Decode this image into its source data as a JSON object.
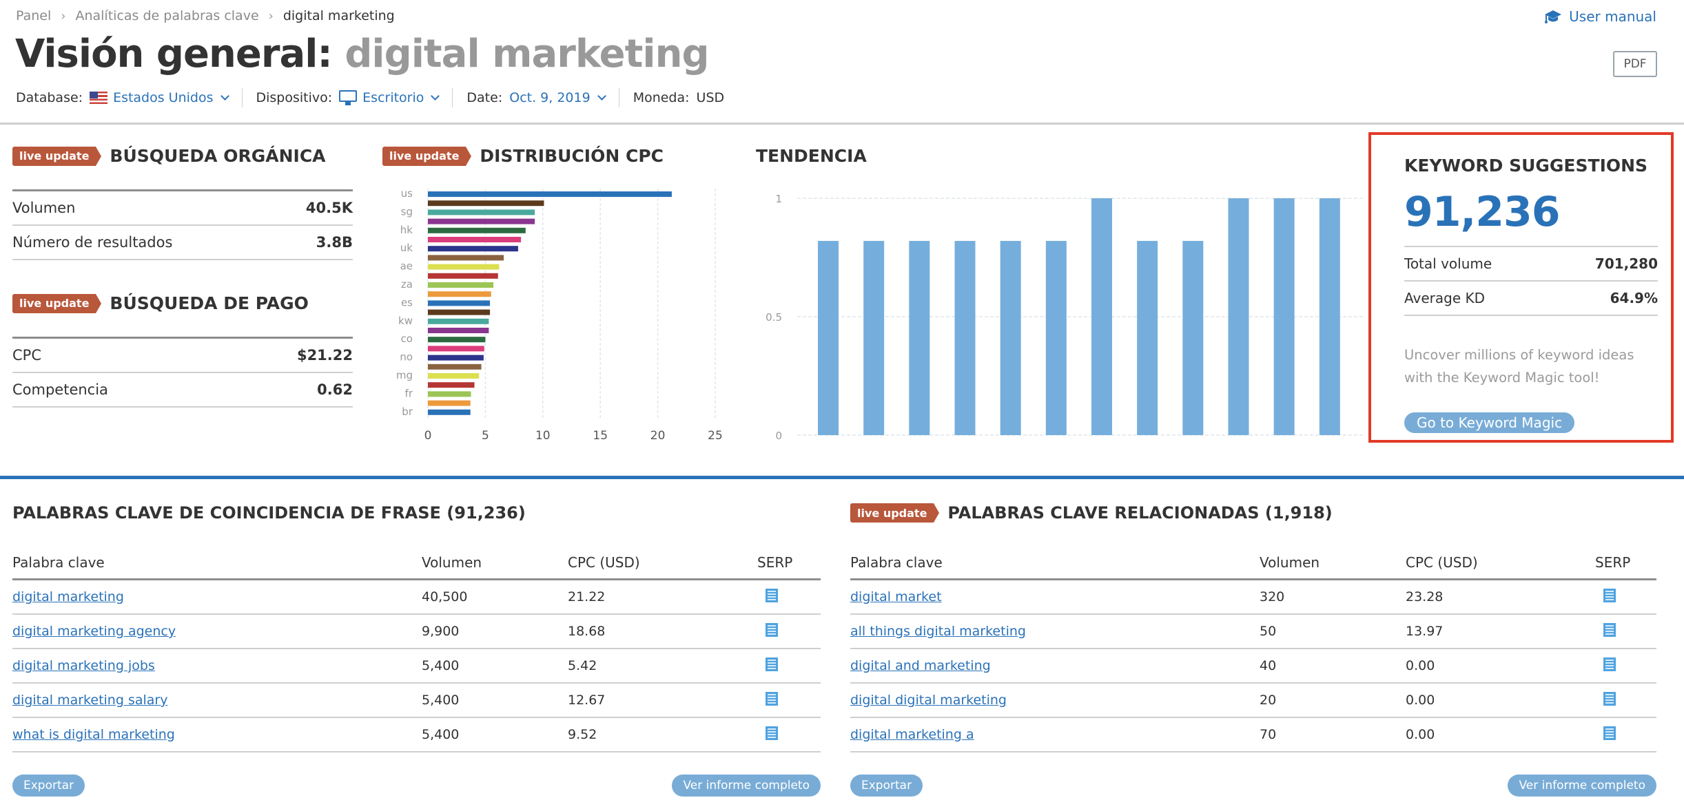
{
  "breadcrumb": [
    "Panel",
    "Analíticas de palabras clave",
    "digital marketing"
  ],
  "header": {
    "user_manual": "User manual",
    "title_prefix": "Visión general:",
    "title_keyword": "digital marketing",
    "pdf_label": "PDF"
  },
  "filters": {
    "database_label": "Database:",
    "database_value": "Estados Unidos",
    "device_label": "Dispositivo:",
    "device_value": "Escritorio",
    "date_label": "Date:",
    "date_value": "Oct. 9, 2019",
    "currency_label": "Moneda:",
    "currency_value": "USD"
  },
  "badge": "live update",
  "organic": {
    "title": "BÚSQUEDA ORGÁNICA",
    "rows": [
      {
        "label": "Volumen",
        "value": "40.5K"
      },
      {
        "label": "Número de resultados",
        "value": "3.8B"
      }
    ]
  },
  "paid": {
    "title": "BÚSQUEDA DE PAGO",
    "rows": [
      {
        "label": "CPC",
        "value": "$21.22"
      },
      {
        "label": "Competencia",
        "value": "0.62"
      }
    ]
  },
  "cpc_panel": {
    "title": "DISTRIBUCIÓN CPC"
  },
  "trend_panel": {
    "title": "TENDENCIA"
  },
  "chart_data": [
    {
      "type": "bar",
      "orientation": "horizontal",
      "title": "DISTRIBUCIÓN CPC",
      "categories": [
        "us",
        "",
        "sg",
        "",
        "hk",
        "",
        "uk",
        "",
        "ae",
        "",
        "za",
        "",
        "es",
        "",
        "kw",
        "",
        "co",
        "",
        "no",
        "",
        "mg",
        "",
        "fr",
        "",
        "br"
      ],
      "values": [
        21.22,
        10.1,
        9.3,
        9.3,
        8.5,
        8.1,
        7.85,
        6.6,
        6.2,
        6.1,
        5.7,
        5.5,
        5.4,
        5.4,
        5.3,
        5.3,
        5.0,
        4.9,
        4.85,
        4.65,
        4.45,
        4.05,
        3.75,
        3.7,
        3.7
      ],
      "colors": [
        "#2a72b8",
        "#5c3a1e",
        "#4aa99d",
        "#8a3590",
        "#2c6b3f",
        "#db3d7c",
        "#2c358c",
        "#8a6240",
        "#dcdf50",
        "#b53634",
        "#9bc554",
        "#ed9a3d",
        "#2a72b8",
        "#5c3a1e",
        "#4aa99d",
        "#8a3590",
        "#2c6b3f",
        "#db3d7c",
        "#2c358c",
        "#8a6240",
        "#dcdf50",
        "#b53634",
        "#9bc554",
        "#ed9a3d",
        "#2a72b8"
      ],
      "xlim": [
        0,
        25
      ],
      "xticks": [
        0,
        5,
        10,
        15,
        20,
        25
      ],
      "grid": true,
      "xlabel": "",
      "ylabel": ""
    },
    {
      "type": "bar",
      "title": "TENDENCIA",
      "values": [
        0.82,
        0.82,
        0.82,
        0.82,
        0.82,
        0.82,
        1,
        0.82,
        0.82,
        1,
        1,
        1
      ],
      "ylim": [
        0,
        1
      ],
      "yticks": [
        "0",
        "0.5",
        "1"
      ],
      "color": "#75aedc",
      "grid": true
    }
  ],
  "keyword_suggestions": {
    "title": "KEYWORD SUGGESTIONS",
    "count": "91,236",
    "rows": [
      {
        "label": "Total volume",
        "value": "701,280"
      },
      {
        "label": "Average KD",
        "value": "64.9%"
      }
    ],
    "note": "Uncover millions of keyword ideas with the Keyword Magic tool!",
    "button": "Go to Keyword Magic"
  },
  "phrase_match": {
    "title": "PALABRAS CLAVE DE COINCIDENCIA DE FRASE (91,236)",
    "columns": [
      "Palabra clave",
      "Volumen",
      "CPC (USD)",
      "SERP"
    ],
    "rows": [
      {
        "keyword": "digital marketing",
        "volume": "40,500",
        "cpc": "21.22"
      },
      {
        "keyword": "digital marketing agency",
        "volume": "9,900",
        "cpc": "18.68"
      },
      {
        "keyword": "digital marketing jobs",
        "volume": "5,400",
        "cpc": "5.42"
      },
      {
        "keyword": "digital marketing salary",
        "volume": "5,400",
        "cpc": "12.67"
      },
      {
        "keyword": "what is digital marketing",
        "volume": "5,400",
        "cpc": "9.52"
      }
    ],
    "export": "Exportar",
    "full_report": "Ver informe completo"
  },
  "related": {
    "title": "PALABRAS CLAVE RELACIONADAS (1,918)",
    "columns": [
      "Palabra clave",
      "Volumen",
      "CPC (USD)",
      "SERP"
    ],
    "rows": [
      {
        "keyword": "digital market",
        "volume": "320",
        "cpc": "23.28"
      },
      {
        "keyword": "all things digital marketing",
        "volume": "50",
        "cpc": "13.97"
      },
      {
        "keyword": "digital and marketing",
        "volume": "40",
        "cpc": "0.00"
      },
      {
        "keyword": "digital digital marketing",
        "volume": "20",
        "cpc": "0.00"
      },
      {
        "keyword": "digital marketing a",
        "volume": "70",
        "cpc": "0.00"
      }
    ],
    "export": "Exportar",
    "full_report": "Ver informe completo"
  },
  "colors": {
    "accent": "#2a72b8",
    "badge": "#b9573b",
    "highlight_border": "#e23a27",
    "button": "#78acd6"
  }
}
